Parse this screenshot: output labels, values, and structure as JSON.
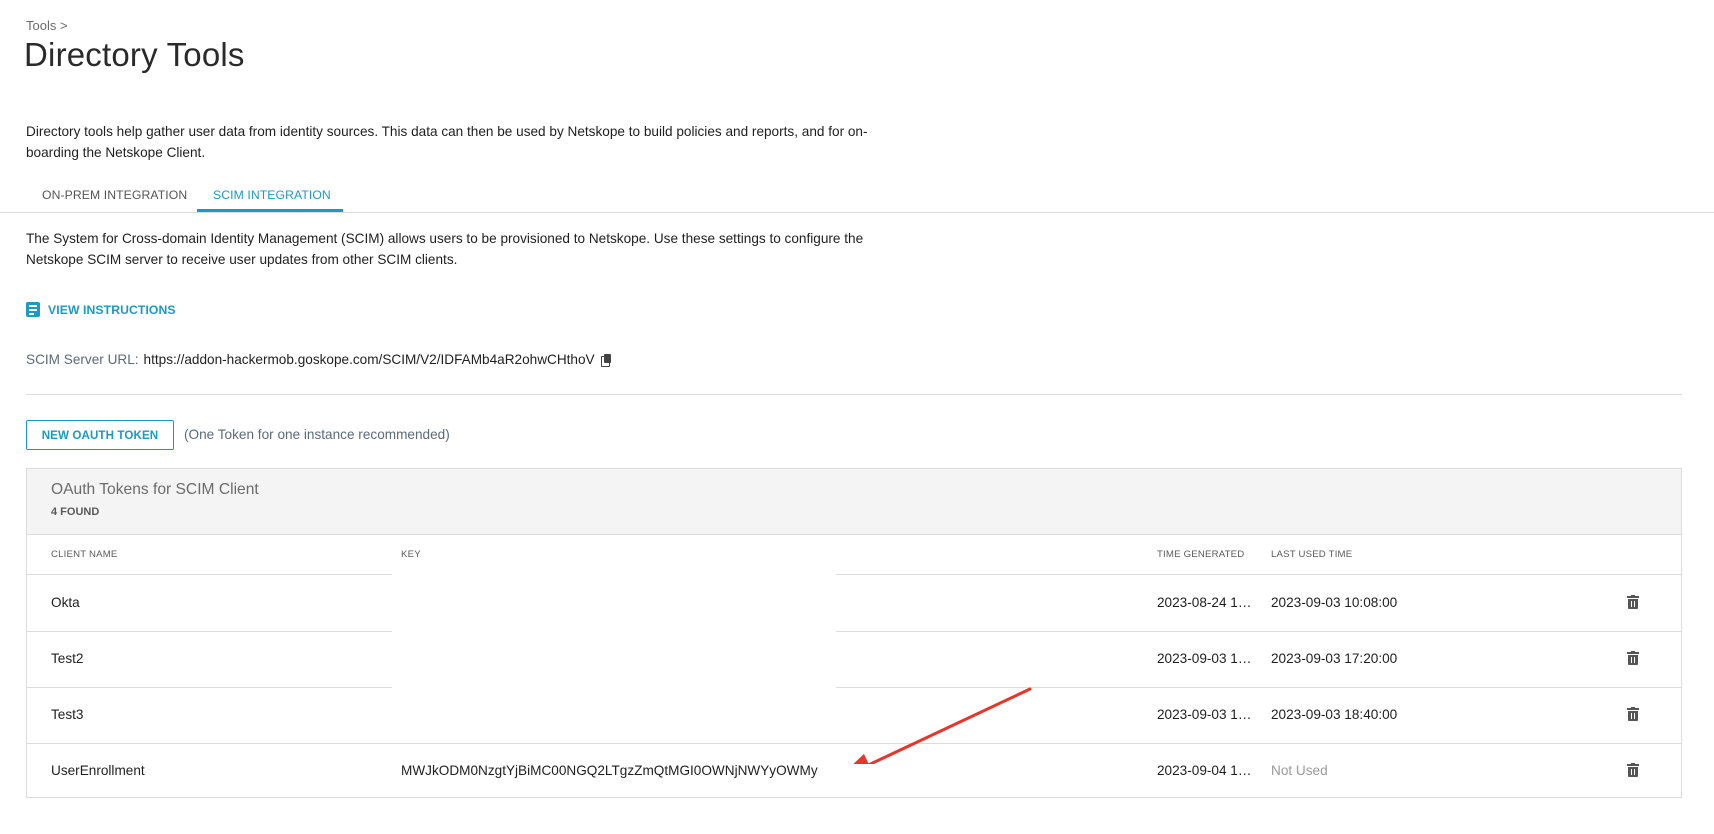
{
  "breadcrumb": "Tools >",
  "page_title": "Directory Tools",
  "intro": "Directory tools help gather user data from identity sources. This data can then be used by Netskope to build policies and reports, and for on-boarding the Netskope Client.",
  "tabs": [
    {
      "label": "ON-PREM INTEGRATION",
      "active": false
    },
    {
      "label": "SCIM INTEGRATION",
      "active": true
    }
  ],
  "scim_description": "The System for Cross-domain Identity Management (SCIM) allows users to be provisioned to Netskope. Use these settings to configure the Netskope SCIM server to receive user updates from other SCIM clients.",
  "view_instructions": "VIEW INSTRUCTIONS",
  "scim_url": {
    "label": "SCIM Server URL:",
    "value": "https://addon-hackermob.goskope.com/SCIM/V2/IDFAMb4aR2ohwCHthoV"
  },
  "new_token_button": "NEW OAUTH TOKEN",
  "token_hint": "(One Token for one instance recommended)",
  "tokens_panel": {
    "title": "OAuth Tokens for SCIM Client",
    "count": "4 FOUND",
    "columns": [
      "CLIENT NAME",
      "KEY",
      "TIME GENERATED",
      "LAST USED TIME"
    ],
    "rows": [
      {
        "client_name": "Okta",
        "key": "",
        "time_generated": "2023-08-24 1…",
        "last_used": "2023-09-03 10:08:00"
      },
      {
        "client_name": "Test2",
        "key": "",
        "time_generated": "2023-09-03 1…",
        "last_used": "2023-09-03 17:20:00"
      },
      {
        "client_name": "Test3",
        "key": "",
        "time_generated": "2023-09-03 1…",
        "last_used": "2023-09-03 18:40:00"
      },
      {
        "client_name": "UserEnrollment",
        "key": "MWJkODM0NzgtYjBiMC00NGQ2LTgzZmQtMGI0OWNjNWYyOWMy",
        "time_generated": "2023-09-04 1…",
        "last_used": "Not Used"
      }
    ]
  },
  "colors": {
    "accent": "#1a9ac4",
    "annotation_arrow": "#e8352a"
  },
  "icons": [
    "document-icon",
    "copy-icon",
    "trash-icon"
  ]
}
